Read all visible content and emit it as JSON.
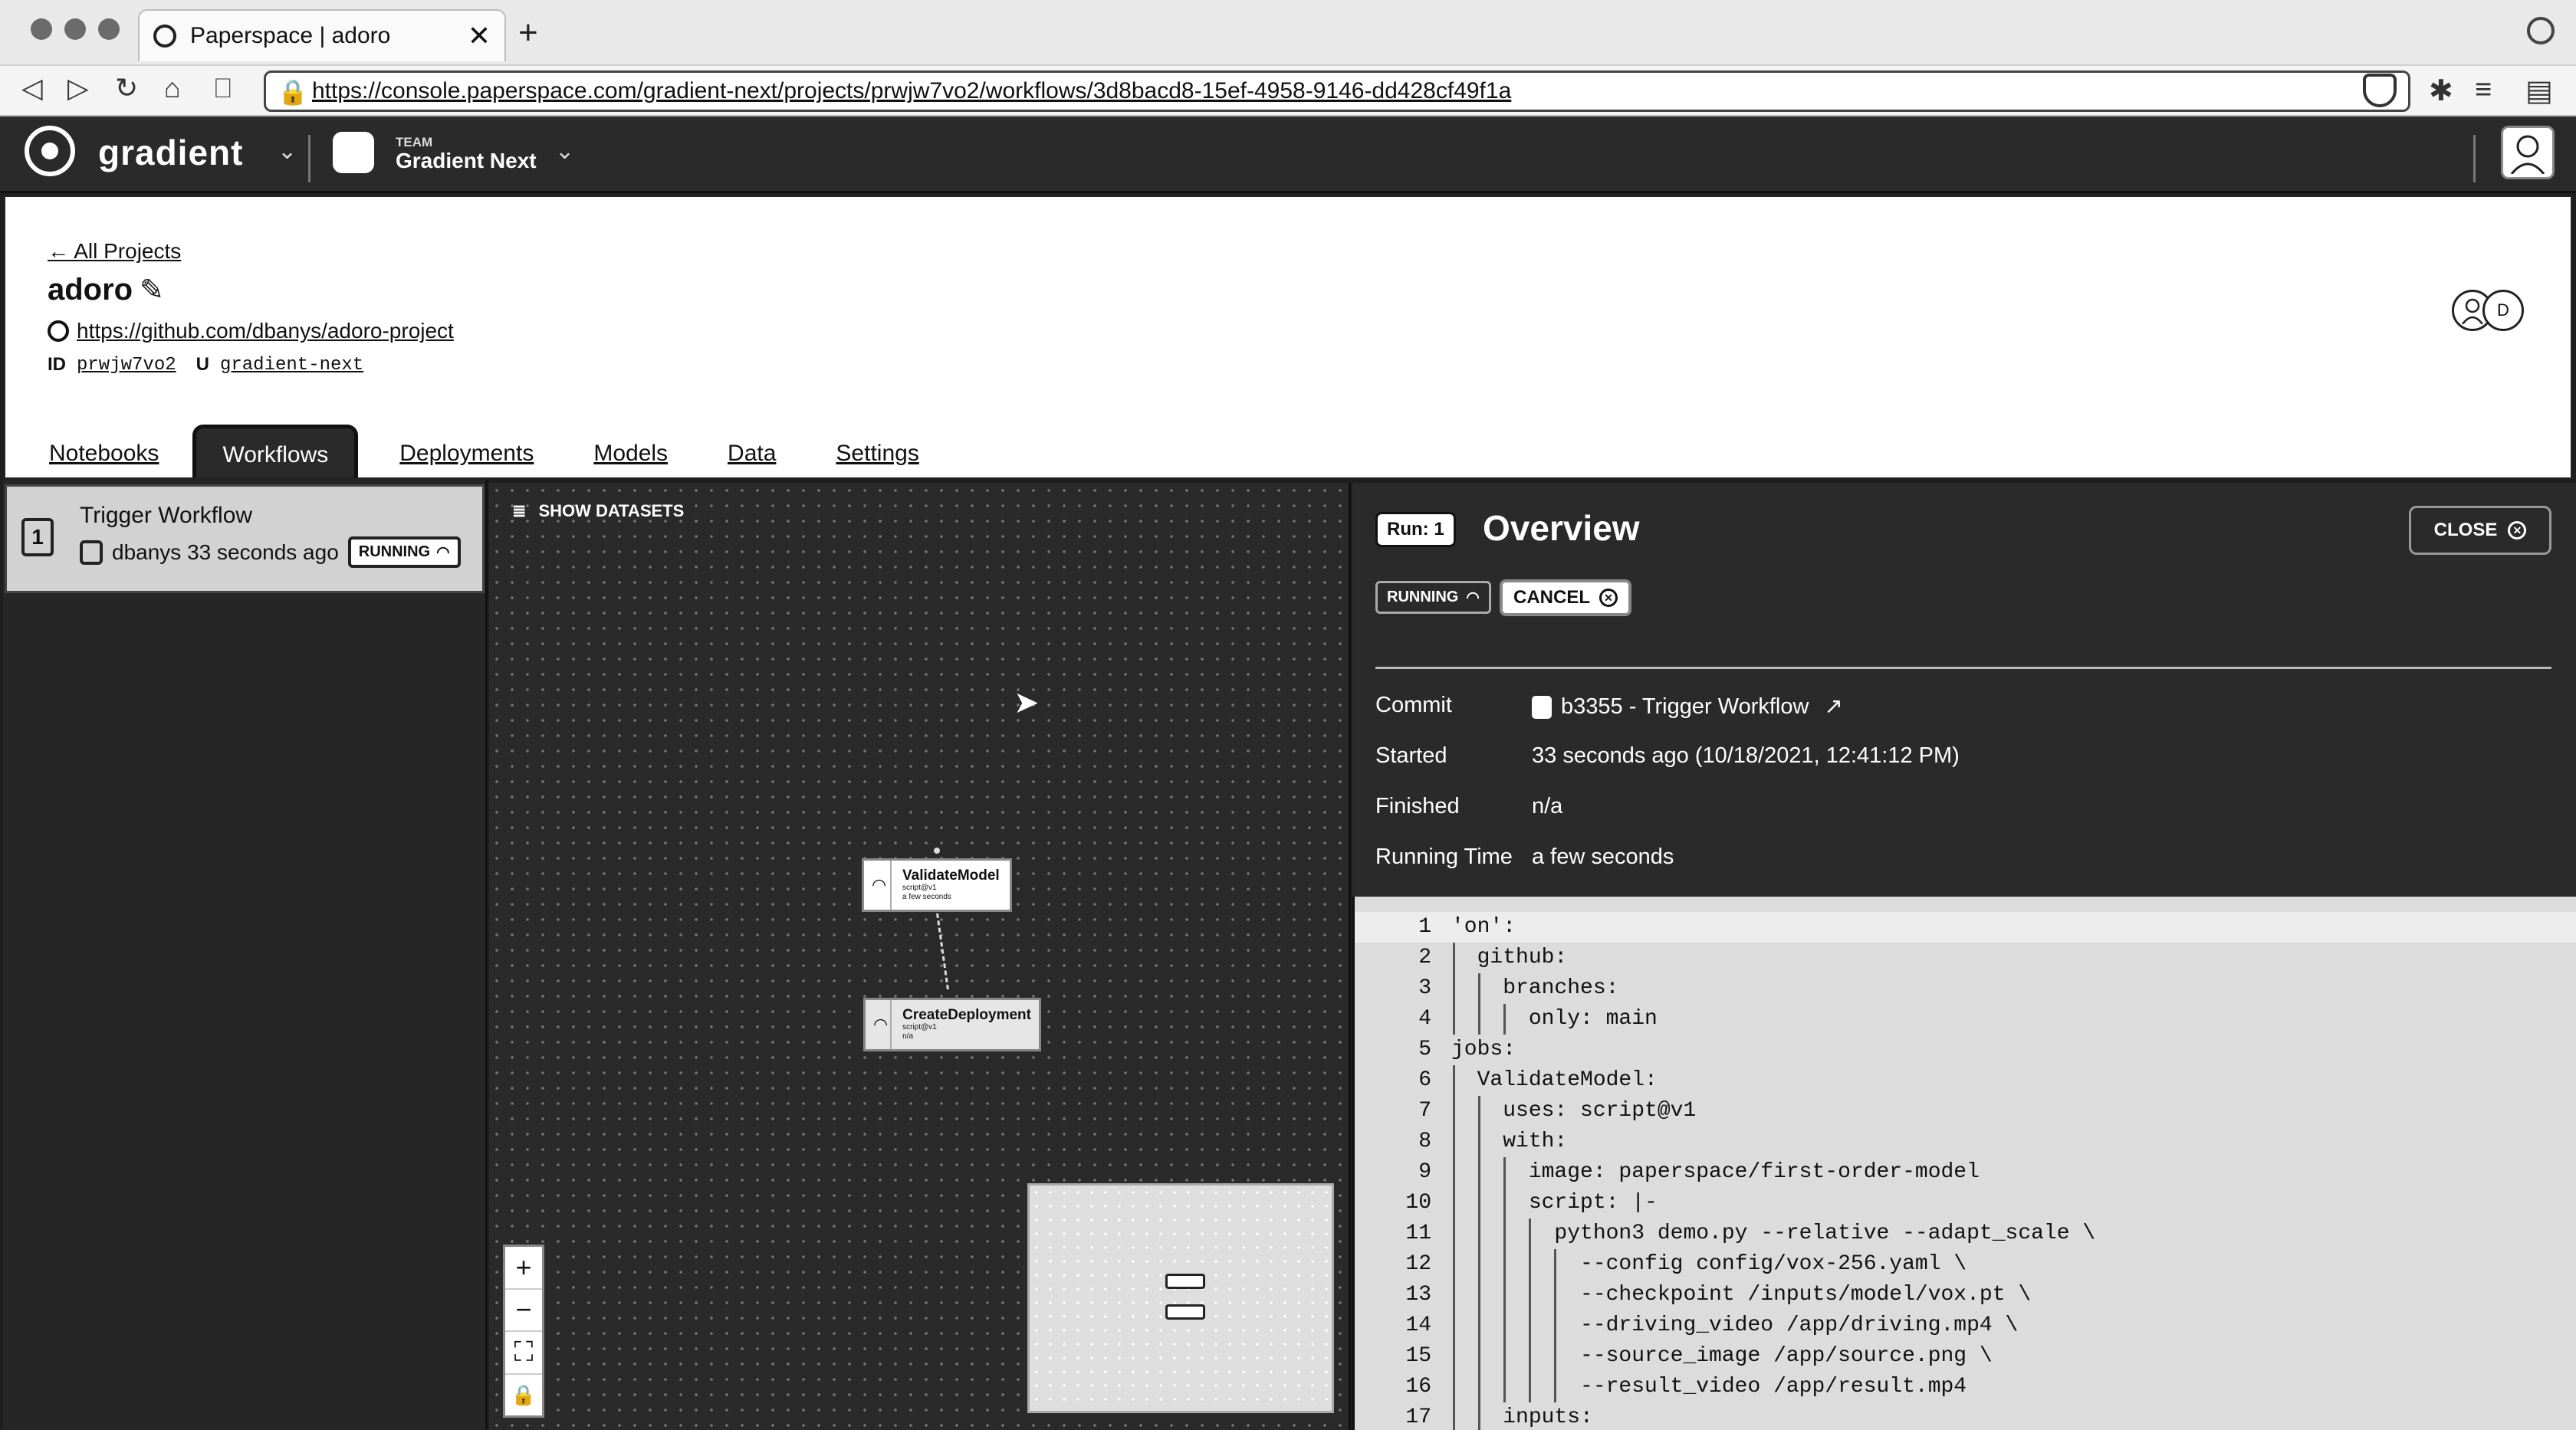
{
  "browser": {
    "tab_title": "Paperspace | adoro",
    "url": "https://console.paperspace.com/gradient-next/projects/prwjw7vo2/workflows/3d8bacd8-15ef-4958-9146-dd428cf49f1a"
  },
  "app": {
    "logo": "gradient",
    "team_label": "TEAM",
    "team_name": "Gradient Next"
  },
  "project": {
    "back_link": "← All Projects",
    "name": "adoro",
    "repo_url": "https://github.com/dbanys/adoro-project",
    "id_label": "ID",
    "id_value": "prwjw7vo2",
    "user_label": "U",
    "user_value": "gradient-next",
    "avatar_initial": "D",
    "tabs": [
      "Notebooks",
      "Workflows",
      "Deployments",
      "Models",
      "Data",
      "Settings"
    ],
    "active_tab": "Workflows"
  },
  "runs": [
    {
      "number": "1",
      "title": "Trigger Workflow",
      "meta": "dbanys 33 seconds ago",
      "status": "RUNNING"
    }
  ],
  "canvas": {
    "show_datasets": "SHOW DATASETS",
    "nodes": [
      {
        "title": "ValidateModel",
        "sub1": "script@v1",
        "sub2": "a few seconds"
      },
      {
        "title": "CreateDeployment",
        "sub1": "script@v1",
        "sub2": "n/a"
      }
    ],
    "zoom": [
      "+",
      "−",
      "⛶",
      "🔒"
    ]
  },
  "overview": {
    "run_badge": "Run: 1",
    "title": "Overview",
    "close_label": "CLOSE",
    "status": "RUNNING",
    "cancel_label": "CANCEL",
    "details": [
      {
        "key": "Commit",
        "value": "b3355 - Trigger Workflow"
      },
      {
        "key": "Started",
        "value": "33 seconds ago (10/18/2021, 12:41:12 PM)"
      },
      {
        "key": "Finished",
        "value": "n/a"
      },
      {
        "key": "Running Time",
        "value": "a few seconds"
      }
    ]
  },
  "code": [
    "'on':",
    "  github:",
    "    branches:",
    "      only: main",
    "jobs:",
    "  ValidateModel:",
    "    uses: script@v1",
    "    with:",
    "      image: paperspace/first-order-model",
    "      script: |-",
    "        python3 demo.py --relative --adapt_scale \\",
    "          --config config/vox-256.yaml \\",
    "          --checkpoint /inputs/model/vox.pt \\",
    "          --driving_video /app/driving.mp4 \\",
    "          --source_image /app/source.png \\",
    "          --result_video /app/result.mp4",
    "    inputs:"
  ]
}
